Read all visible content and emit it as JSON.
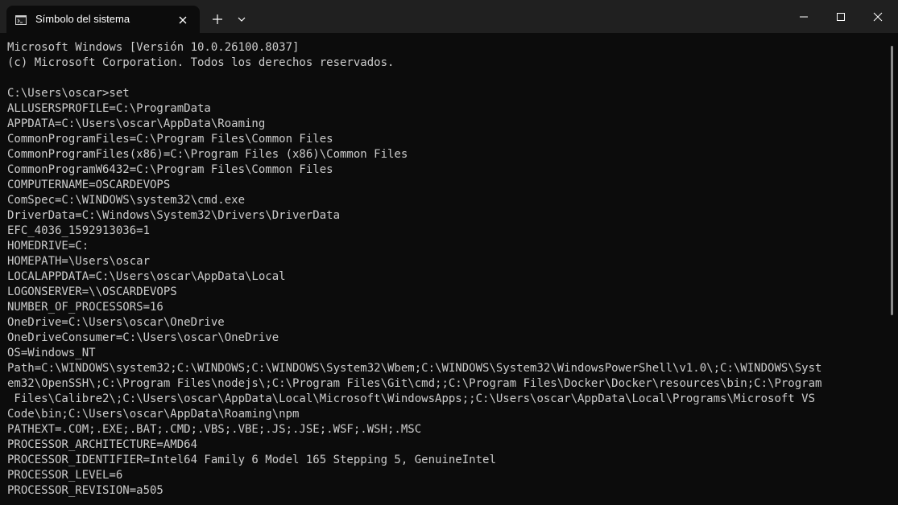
{
  "window": {
    "tab": {
      "title": "Símbolo del sistema",
      "icon": "terminal-icon"
    },
    "new_tab_icon": "plus-icon",
    "dropdown_icon": "chevron-down-icon",
    "caption": {
      "minimize_icon": "minimize-icon",
      "maximize_icon": "maximize-icon",
      "close_icon": "close-icon"
    },
    "colors": {
      "titlebar": "#202020",
      "console_bg": "#0c0c0c",
      "text": "#cccccc"
    }
  },
  "console": {
    "lines": [
      "Microsoft Windows [Versión 10.0.26100.8037]",
      "(c) Microsoft Corporation. Todos los derechos reservados.",
      "",
      "C:\\Users\\oscar>set",
      "ALLUSERSPROFILE=C:\\ProgramData",
      "APPDATA=C:\\Users\\oscar\\AppData\\Roaming",
      "CommonProgramFiles=C:\\Program Files\\Common Files",
      "CommonProgramFiles(x86)=C:\\Program Files (x86)\\Common Files",
      "CommonProgramW6432=C:\\Program Files\\Common Files",
      "COMPUTERNAME=OSCARDEVOPS",
      "ComSpec=C:\\WINDOWS\\system32\\cmd.exe",
      "DriverData=C:\\Windows\\System32\\Drivers\\DriverData",
      "EFC_4036_1592913036=1",
      "HOMEDRIVE=C:",
      "HOMEPATH=\\Users\\oscar",
      "LOCALAPPDATA=C:\\Users\\oscar\\AppData\\Local",
      "LOGONSERVER=\\\\OSCARDEVOPS",
      "NUMBER_OF_PROCESSORS=16",
      "OneDrive=C:\\Users\\oscar\\OneDrive",
      "OneDriveConsumer=C:\\Users\\oscar\\OneDrive",
      "OS=Windows_NT",
      "Path=C:\\WINDOWS\\system32;C:\\WINDOWS;C:\\WINDOWS\\System32\\Wbem;C:\\WINDOWS\\System32\\WindowsPowerShell\\v1.0\\;C:\\WINDOWS\\Syst",
      "em32\\OpenSSH\\;C:\\Program Files\\nodejs\\;C:\\Program Files\\Git\\cmd;;C:\\Program Files\\Docker\\Docker\\resources\\bin;C:\\Program",
      " Files\\Calibre2\\;C:\\Users\\oscar\\AppData\\Local\\Microsoft\\WindowsApps;;C:\\Users\\oscar\\AppData\\Local\\Programs\\Microsoft VS",
      "Code\\bin;C:\\Users\\oscar\\AppData\\Roaming\\npm",
      "PATHEXT=.COM;.EXE;.BAT;.CMD;.VBS;.VBE;.JS;.JSE;.WSF;.WSH;.MSC",
      "PROCESSOR_ARCHITECTURE=AMD64",
      "PROCESSOR_IDENTIFIER=Intel64 Family 6 Model 165 Stepping 5, GenuineIntel",
      "PROCESSOR_LEVEL=6",
      "PROCESSOR_REVISION=a505"
    ]
  }
}
